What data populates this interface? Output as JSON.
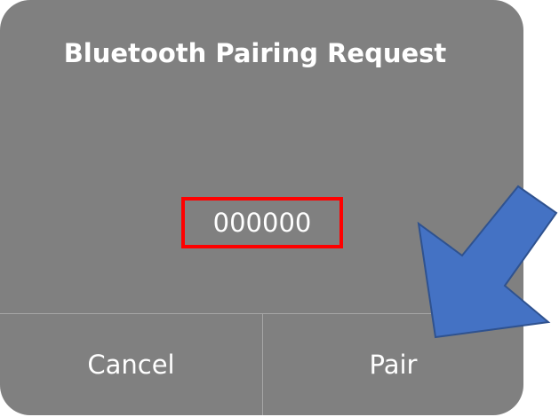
{
  "dialog": {
    "title": "Bluetooth Pairing Request",
    "code": "000000",
    "cancel_label": "Cancel",
    "pair_label": "Pair"
  },
  "colors": {
    "dialog_bg": "#808080",
    "highlight_border": "#ff0000",
    "arrow_fill": "#4472c4",
    "arrow_stroke": "#2f528f"
  },
  "annotations": {
    "arrow_icon": "arrow-pointing-down-left-icon"
  }
}
